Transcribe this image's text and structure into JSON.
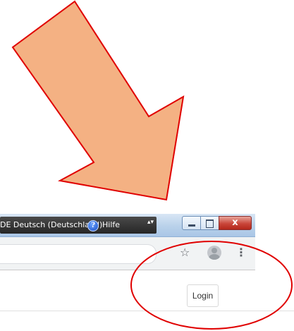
{
  "taskbar": {
    "language_label": "DE Deutsch (Deutschland)",
    "help_icon_glyph": "?",
    "help_label": "Hilfe",
    "more_glyph": "▴▾"
  },
  "window_controls": {
    "close_glyph": "x"
  },
  "browser": {
    "bookmark_icon_glyph": "☆",
    "menu_icon_glyph": "⋮"
  },
  "page": {
    "login_label": "Login"
  },
  "annotation": {
    "arrow_fill": "#f4b183",
    "stroke_color": "#e00000"
  },
  "colors": {
    "langbar_bg": "#2f2f2f",
    "titlebar_bg": "#b9d1ea",
    "close_button": "#c9463a",
    "toolbar_bg": "#f1f3f4"
  }
}
